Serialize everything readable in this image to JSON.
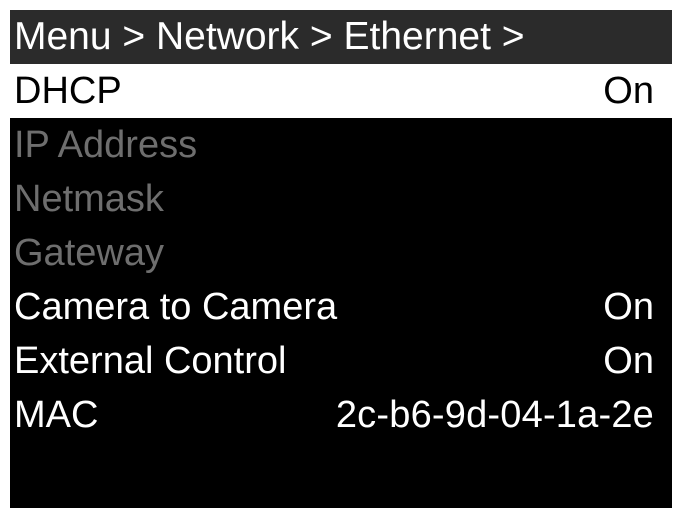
{
  "breadcrumb": "Menu > Network > Ethernet >",
  "rows": [
    {
      "label": "DHCP",
      "value": "On"
    },
    {
      "label": "IP Address",
      "value": ""
    },
    {
      "label": "Netmask",
      "value": ""
    },
    {
      "label": "Gateway",
      "value": ""
    },
    {
      "label": "Camera to Camera",
      "value": "On"
    },
    {
      "label": "External Control",
      "value": "On"
    },
    {
      "label": "MAC",
      "value": "2c-b6-9d-04-1a-2e"
    }
  ],
  "colors": {
    "background": "#000000",
    "header_bg": "#2b2b2b",
    "selected_bg": "#ffffff",
    "disabled_text": "#6e6e6e"
  }
}
